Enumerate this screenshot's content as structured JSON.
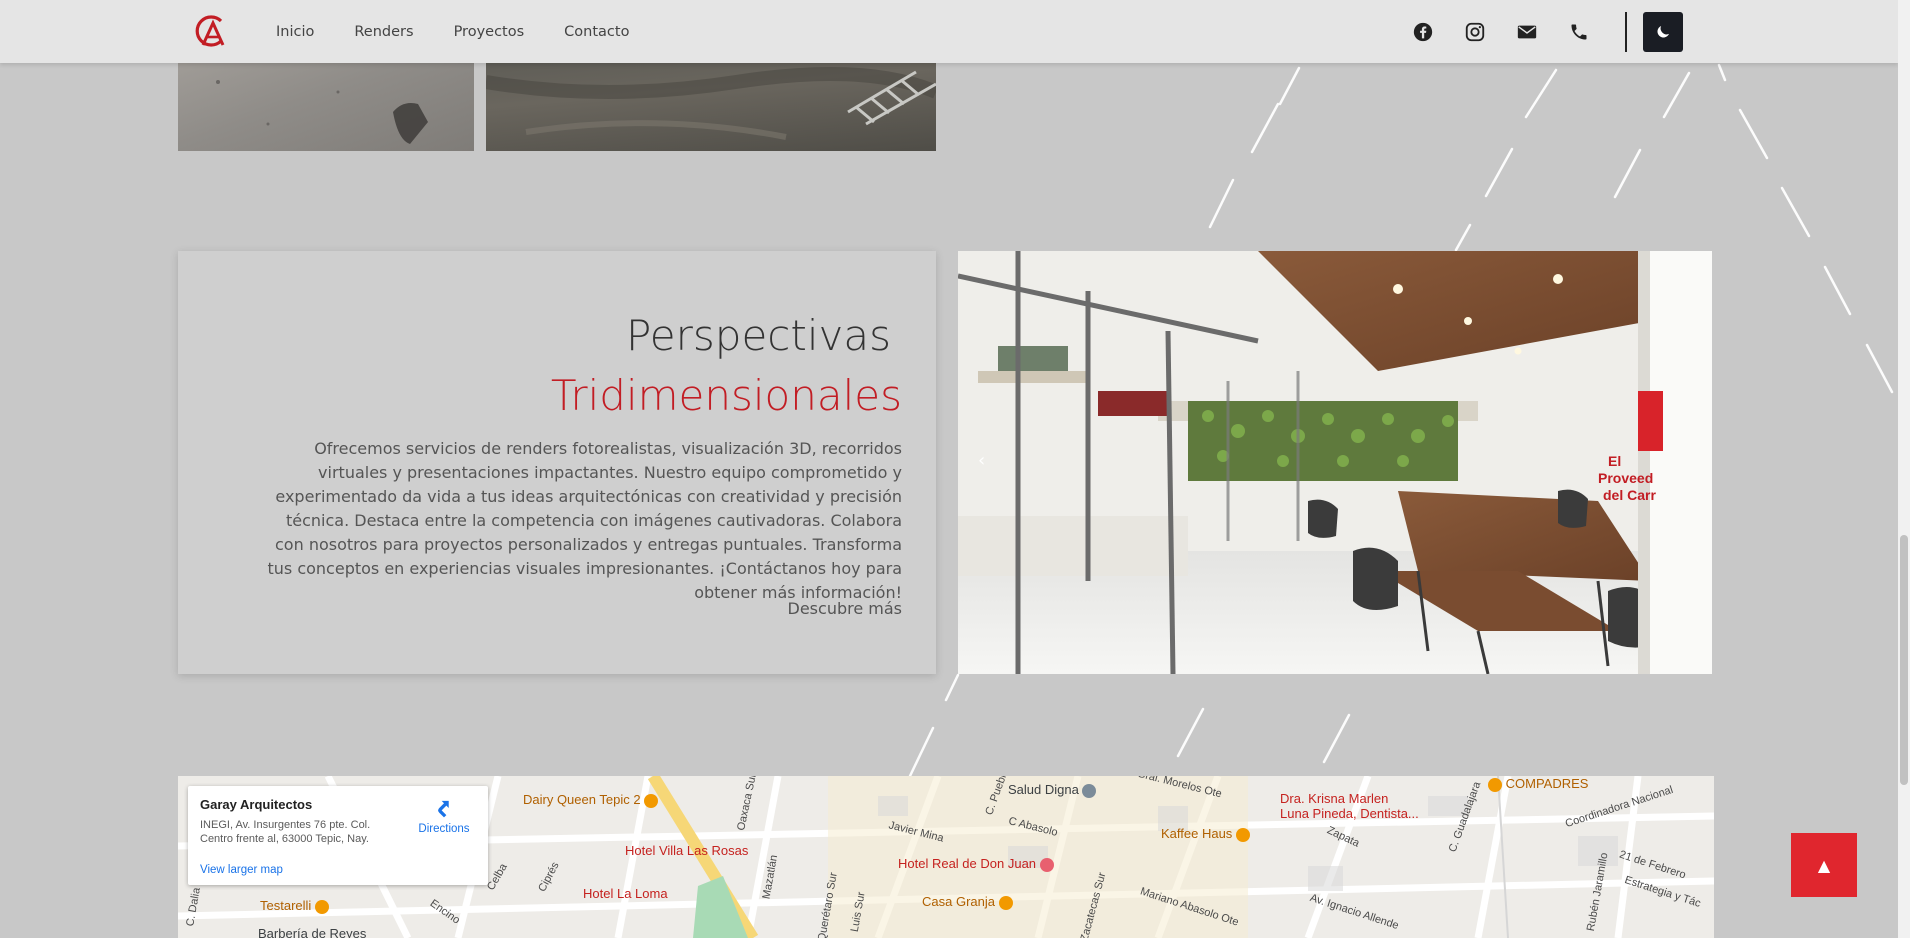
{
  "nav": {
    "links": [
      "Inicio",
      "Renders",
      "Proyectos",
      "Contacto"
    ],
    "icons": [
      "facebook-icon",
      "instagram-icon",
      "mail-icon",
      "phone-icon"
    ],
    "theme_toggle_icon": "moon-icon",
    "brand_color": "#c21d24"
  },
  "perspectivas": {
    "title_line1": "Perspectivas",
    "title_line2": "Tridimensionales",
    "body": "Ofrecemos servicios de renders fotorealistas, visualización 3D, recorridos virtuales y presentaciones impactantes. Nuestro equipo comprometido y experimentado da vida a tus ideas arquitectónicas con creatividad y precisión técnica. Destaca entre la competencia con imágenes cautivadoras. Colabora con nosotros para proyectos personalizados y entregas puntuales. Transforma tus conceptos en experiencias visuales impresionantes. ¡Contáctanos hoy para obtener más información!",
    "cta": "Descubre más",
    "render_sign": [
      "El",
      "Proveed",
      "del Carr"
    ],
    "slider_prev": "‹"
  },
  "map": {
    "place_name": "Garay Arquitectos",
    "address": "INEGI, Av. Insurgentes 76 pte. Col. Centro frente al, 63000 Tepic, Nay.",
    "directions": "Directions",
    "larger_map": "View larger map",
    "pois": [
      {
        "label": "Dairy Queen Tepic 2",
        "color": "#b06000"
      },
      {
        "label": "Salud Digna",
        "color": "#3c4043"
      },
      {
        "label": "Dra. Krisna Marlen",
        "color": "#c5221f"
      },
      {
        "label": "Luna Pineda, Dentista...",
        "color": "#c5221f"
      },
      {
        "label": "COMPADRES",
        "color": "#b06000"
      },
      {
        "label": "Kaffee Haus",
        "color": "#b06000"
      },
      {
        "label": "Hotel Villa Las Rosas",
        "color": "#c5221f"
      },
      {
        "label": "Hotel Real de Don Juan",
        "color": "#c5221f"
      },
      {
        "label": "Hotel La Loma",
        "color": "#c5221f"
      },
      {
        "label": "Casa Granja",
        "color": "#b06000"
      },
      {
        "label": "Testarelli",
        "color": "#b06000"
      },
      {
        "label": "Barbería de Reyes",
        "color": "#3c4043"
      }
    ],
    "streets": [
      "Oaxaca Sur",
      "C Abasolo",
      "Javier Mina",
      "Zapata",
      "C. Guadalajara",
      "Coordinadora Nacional",
      "21 de Febrero",
      "Estrategia y Tác",
      "Rubén Jaramillo",
      "Av. Ignacio Allende",
      "Mariano Abasolo Ote",
      "Zacatecas Sur",
      "Mazatlán",
      "Querétaro Sur",
      "Celba",
      "Encino",
      "Ciprés",
      "C. Dalia",
      "C. Puebla",
      "Gral. Morelos Ote",
      "Luis Sur"
    ]
  },
  "back_to_top": "▲"
}
